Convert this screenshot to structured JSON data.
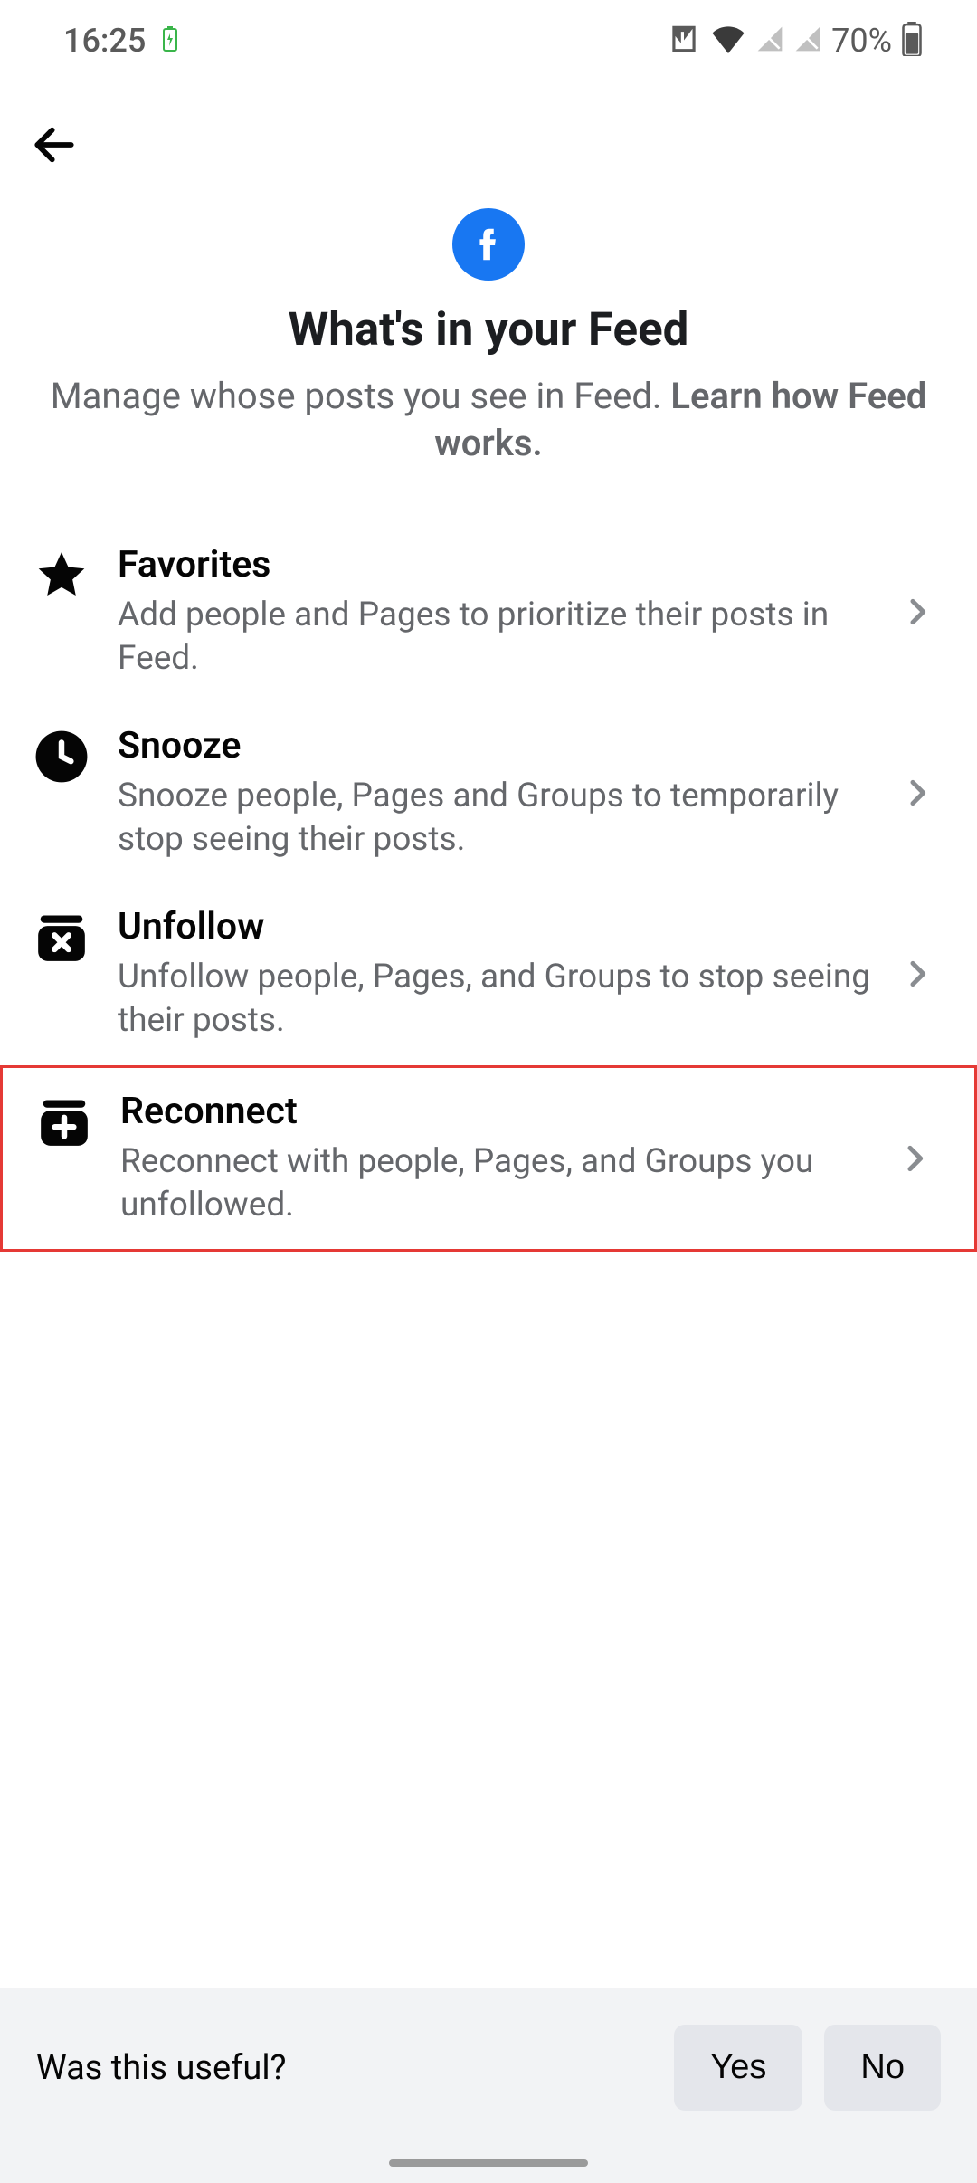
{
  "status": {
    "time": "16:25",
    "battery": "70%"
  },
  "header": {
    "title": "What's in your Feed",
    "subtitle_prefix": "Manage whose posts you see in Feed. ",
    "subtitle_link": "Learn how Feed works."
  },
  "options": [
    {
      "title": "Favorites",
      "desc": "Add people and Pages to prioritize their posts in Feed.",
      "icon": "star",
      "highlighted": false
    },
    {
      "title": "Snooze",
      "desc": "Snooze people, Pages and Groups to temporarily stop seeing their posts.",
      "icon": "clock",
      "highlighted": false
    },
    {
      "title": "Unfollow",
      "desc": "Unfollow people, Pages, and Groups to stop seeing their posts.",
      "icon": "box-x",
      "highlighted": false
    },
    {
      "title": "Reconnect",
      "desc": "Reconnect with people, Pages, and Groups you unfollowed.",
      "icon": "box-plus",
      "highlighted": true
    }
  ],
  "footer": {
    "prompt": "Was this useful?",
    "yes": "Yes",
    "no": "No"
  }
}
